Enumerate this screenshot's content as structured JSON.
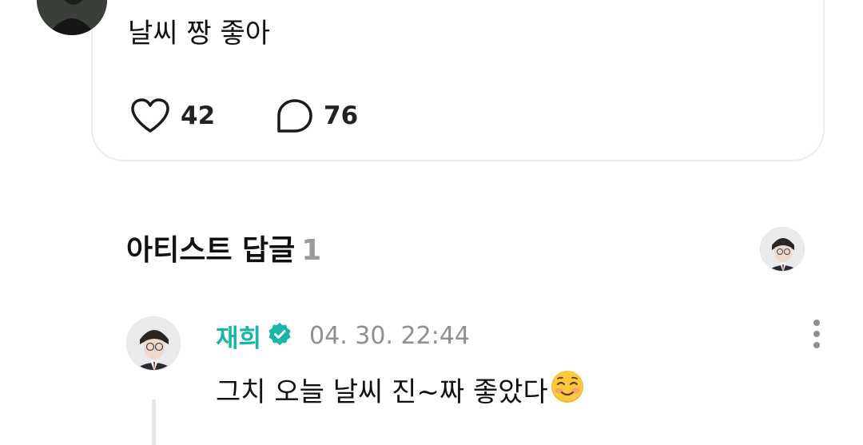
{
  "post": {
    "text": "날씨 짱 좋아",
    "likes": "42",
    "comments": "76"
  },
  "artist_replies": {
    "title": "아티스트 답글",
    "count": "1"
  },
  "reply": {
    "author": "재희",
    "timestamp": "04. 30. 22:44",
    "text": "그치 오늘 날씨 진~짜 좋았다",
    "emoji": "smiling-face-with-blush-emoji"
  },
  "icons": {
    "like": "heart-icon",
    "comment": "comment-bubble-icon",
    "verified": "verified-badge-icon",
    "more": "more-vertical-icon"
  },
  "colors": {
    "accent": "#18b5a8",
    "muted": "#8e8e93",
    "border": "#ececef"
  }
}
